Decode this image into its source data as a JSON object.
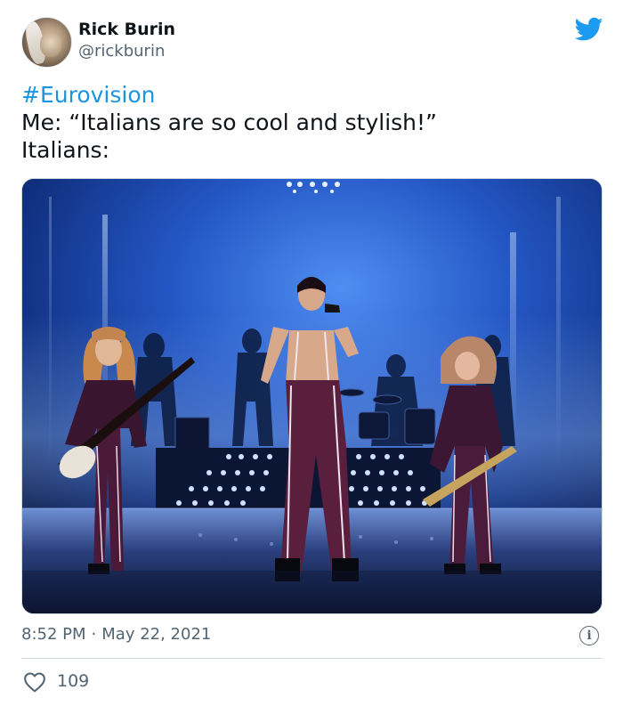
{
  "tweet": {
    "author_name": "Rick Burin",
    "author_handle": "@rickburin",
    "hashtag": "#Eurovision",
    "line2": "Me: “Italians are so cool and stylish!”",
    "line3": "Italians:",
    "time": "8:52 PM",
    "separator": "·",
    "date": "May 22, 2021",
    "like_count": "109"
  },
  "icons": {
    "platform": "twitter-bird-icon",
    "info": "info-icon",
    "like": "heart-icon"
  },
  "colors": {
    "accent": "#1b95e0",
    "text_primary": "#0f1419",
    "text_secondary": "#536471",
    "divider": "#cfd9de"
  }
}
